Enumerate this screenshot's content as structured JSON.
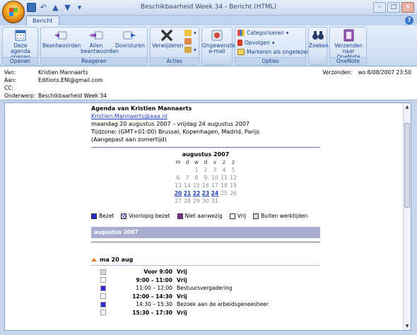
{
  "window": {
    "title": "Beschikbaarheid Week 34 - Bericht (HTML)"
  },
  "ribbon": {
    "active_tab": "Bericht",
    "groups": {
      "openen": {
        "label": "Openen",
        "btn": "Deze agenda openen"
      },
      "reageren": {
        "label": "Reageren",
        "btn_reply": "Beantwoorden",
        "btn_reply_all": "Allen beantwoorden",
        "btn_forward": "Doorsturen"
      },
      "acties": {
        "label": "Acties",
        "btn_delete": "Verwijderen"
      },
      "ongewenst": {
        "label": "Ongewenste e-mail"
      },
      "opties": {
        "label": "Opties",
        "categorize": "Categoriseren",
        "followup": "Opvolgen",
        "mark_unread": "Markeren als ongelezen"
      },
      "zoeken": {
        "label": "Zoeken"
      },
      "onenote": {
        "label": "OneNote",
        "btn": "Verzenden naar OneNote"
      }
    }
  },
  "headers": {
    "van_label": "Van:",
    "van_value": "Kristien Mannaerts",
    "aan_label": "Aan:",
    "aan_value": "Editions.ENI@gmail.com",
    "cc_label": "CC:",
    "onderwerp_label": "Onderwerp:",
    "onderwerp_value": "Beschikbaarheid Week 34",
    "verzonden_label": "Verzonden:",
    "verzonden_value": "wo 8/08/2007 23:50"
  },
  "agenda": {
    "title": "Agenda van Kristien Mannaerts",
    "email": "Kristien.Mannaerts@aaa.nl",
    "range": "maandag 20 augustus 2007 – vrijdag 24 augustus 2007",
    "timezone": "Tijdzone: (GMT+01:00) Brussel, Kopenhagen, Madrid, Parijs",
    "dst": "(Aangepast aan zomertijd)"
  },
  "calendar": {
    "month": "augustus 2007",
    "days": [
      "m",
      "d",
      "w",
      "d",
      "v",
      "z",
      "z"
    ],
    "rows": [
      [
        "",
        "",
        "1",
        "2",
        "3",
        "4",
        "5"
      ],
      [
        "6",
        "7",
        "8",
        "9",
        "10",
        "11",
        "12"
      ],
      [
        "13",
        "14",
        "15",
        "16",
        "17",
        "18",
        "19"
      ],
      [
        "20",
        "21",
        "22",
        "23",
        "24",
        "25",
        "26"
      ],
      [
        "27",
        "28",
        "29",
        "30",
        "31",
        "",
        ""
      ]
    ],
    "highlight": [
      "20",
      "21",
      "22",
      "23",
      "24"
    ]
  },
  "legend": [
    {
      "label": "Bezet",
      "color": "#2a2ad0",
      "style": "solid"
    },
    {
      "label": "Voorlopig bezet",
      "color": "#2a2ad0",
      "style": "hatch"
    },
    {
      "label": "Niet aanwezig",
      "color": "#7b2d8e",
      "style": "solid"
    },
    {
      "label": "Vrij",
      "color": "#ffffff",
      "style": "solid"
    },
    {
      "label": "Buiten werktijden",
      "color": "#d8d8d8",
      "style": "solid"
    }
  ],
  "month_bar": "augustus 2007",
  "day": {
    "header": "ma 20 aug",
    "slots": [
      {
        "time": "Voor 9:00",
        "desc": "Vrij",
        "box": "#d8d8d8",
        "bold": true,
        "time_bold": true
      },
      {
        "time": "9:00 – 11:00",
        "desc": "Vrij",
        "box": "#ffffff",
        "bold": true,
        "time_bold": true
      },
      {
        "time": "11:00 – 12:00",
        "desc": "Bestuursvergadering",
        "box": "#2a2ad0",
        "bold": false,
        "time_bold": false
      },
      {
        "time": "12:00 – 14:30",
        "desc": "Vrij",
        "box": "#ffffff",
        "bold": true,
        "time_bold": true
      },
      {
        "time": "14:30 – 15:30",
        "desc": "Bezoek aan de arbeidsgeneesheer",
        "box": "#2a2ad0",
        "bold": false,
        "time_bold": false
      },
      {
        "time": "15:30 – 17:30",
        "desc": "Vrij",
        "box": "#ffffff",
        "bold": true,
        "time_bold": true
      }
    ]
  }
}
